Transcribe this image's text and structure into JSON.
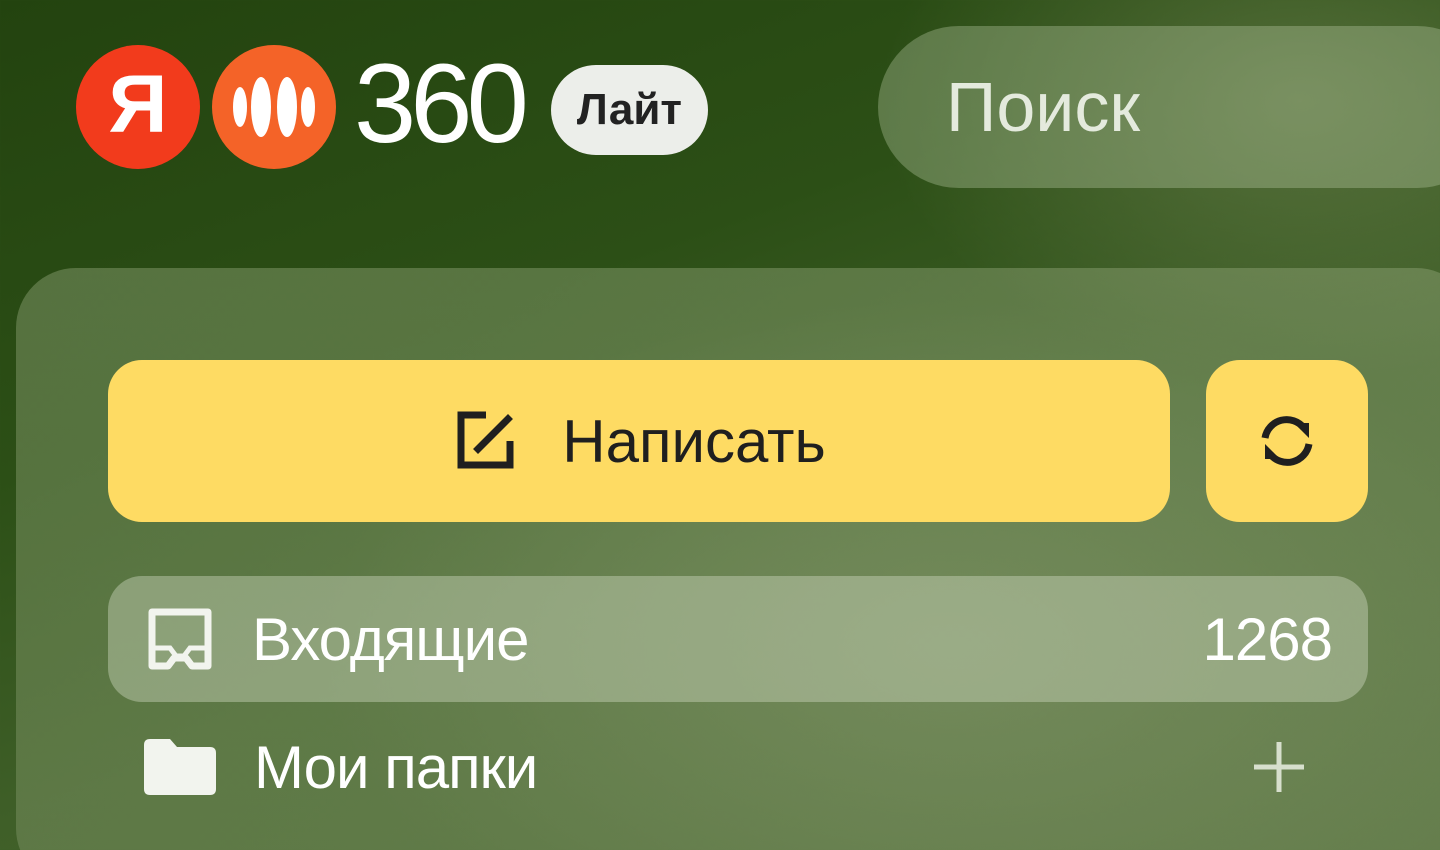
{
  "header": {
    "logo": {
      "ya_letter": "Я",
      "product_number": "360",
      "badge": "Лайт",
      "colors": {
        "ya": "#f23b1c",
        "mail": "#f46328"
      }
    },
    "search": {
      "placeholder": "Поиск",
      "value": ""
    }
  },
  "sidebar": {
    "compose": {
      "label": "Написать",
      "icon": "compose-icon"
    },
    "refresh": {
      "icon": "refresh-icon"
    },
    "folders": [
      {
        "label": "Входящие",
        "count": "1268",
        "icon": "inbox-icon",
        "selected": true
      },
      {
        "label": "Мои папки",
        "icon": "folder-icon",
        "action_icon": "plus-icon"
      }
    ],
    "colors": {
      "accent": "#fedb63"
    }
  }
}
